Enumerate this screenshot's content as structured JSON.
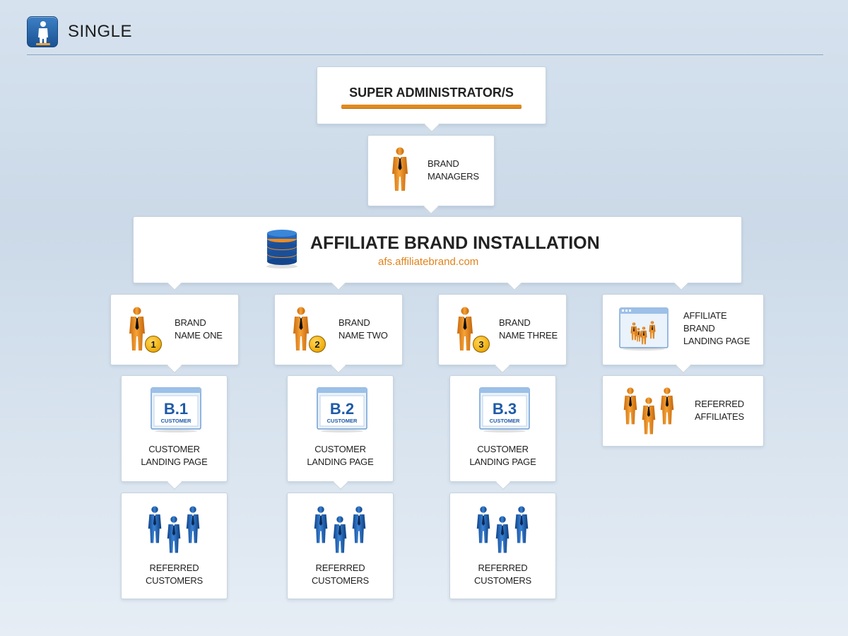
{
  "header": {
    "title": "SINGLE"
  },
  "super_admin": {
    "label": "SUPER ADMINISTRATOR/S"
  },
  "brand_managers": {
    "line1": "BRAND",
    "line2": "MANAGERS"
  },
  "installation": {
    "title": "AFFILIATE BRAND INSTALLATION",
    "url": "afs.affiliatebrand.com"
  },
  "brands": [
    {
      "line1": "BRAND",
      "line2": "NAME ONE",
      "number": "1",
      "code": "B.1",
      "code_sub": "CUSTOMER",
      "landing_line1": "CUSTOMER",
      "landing_line2": "LANDING PAGE",
      "ref_line1": "REFERRED",
      "ref_line2": "CUSTOMERS"
    },
    {
      "line1": "BRAND",
      "line2": "NAME TWO",
      "number": "2",
      "code": "B.2",
      "code_sub": "CUSTOMER",
      "landing_line1": "CUSTOMER",
      "landing_line2": "LANDING PAGE",
      "ref_line1": "REFERRED",
      "ref_line2": "CUSTOMERS"
    },
    {
      "line1": "BRAND",
      "line2": "NAME THREE",
      "number": "3",
      "code": "B.3",
      "code_sub": "CUSTOMER",
      "landing_line1": "CUSTOMER",
      "landing_line2": "LANDING PAGE",
      "ref_line1": "REFERRED",
      "ref_line2": "CUSTOMERS"
    }
  ],
  "affiliate_landing": {
    "line1": "AFFILIATE",
    "line2": "BRAND",
    "line3": "LANDING PAGE"
  },
  "referred_affiliates": {
    "line1": "REFERRED",
    "line2": "AFFILIATES"
  },
  "colors": {
    "accent_orange": "#e08a1e",
    "person_orange": "#e8891c",
    "person_blue": "#1f63b3",
    "header_blue": "#2a69b0"
  }
}
